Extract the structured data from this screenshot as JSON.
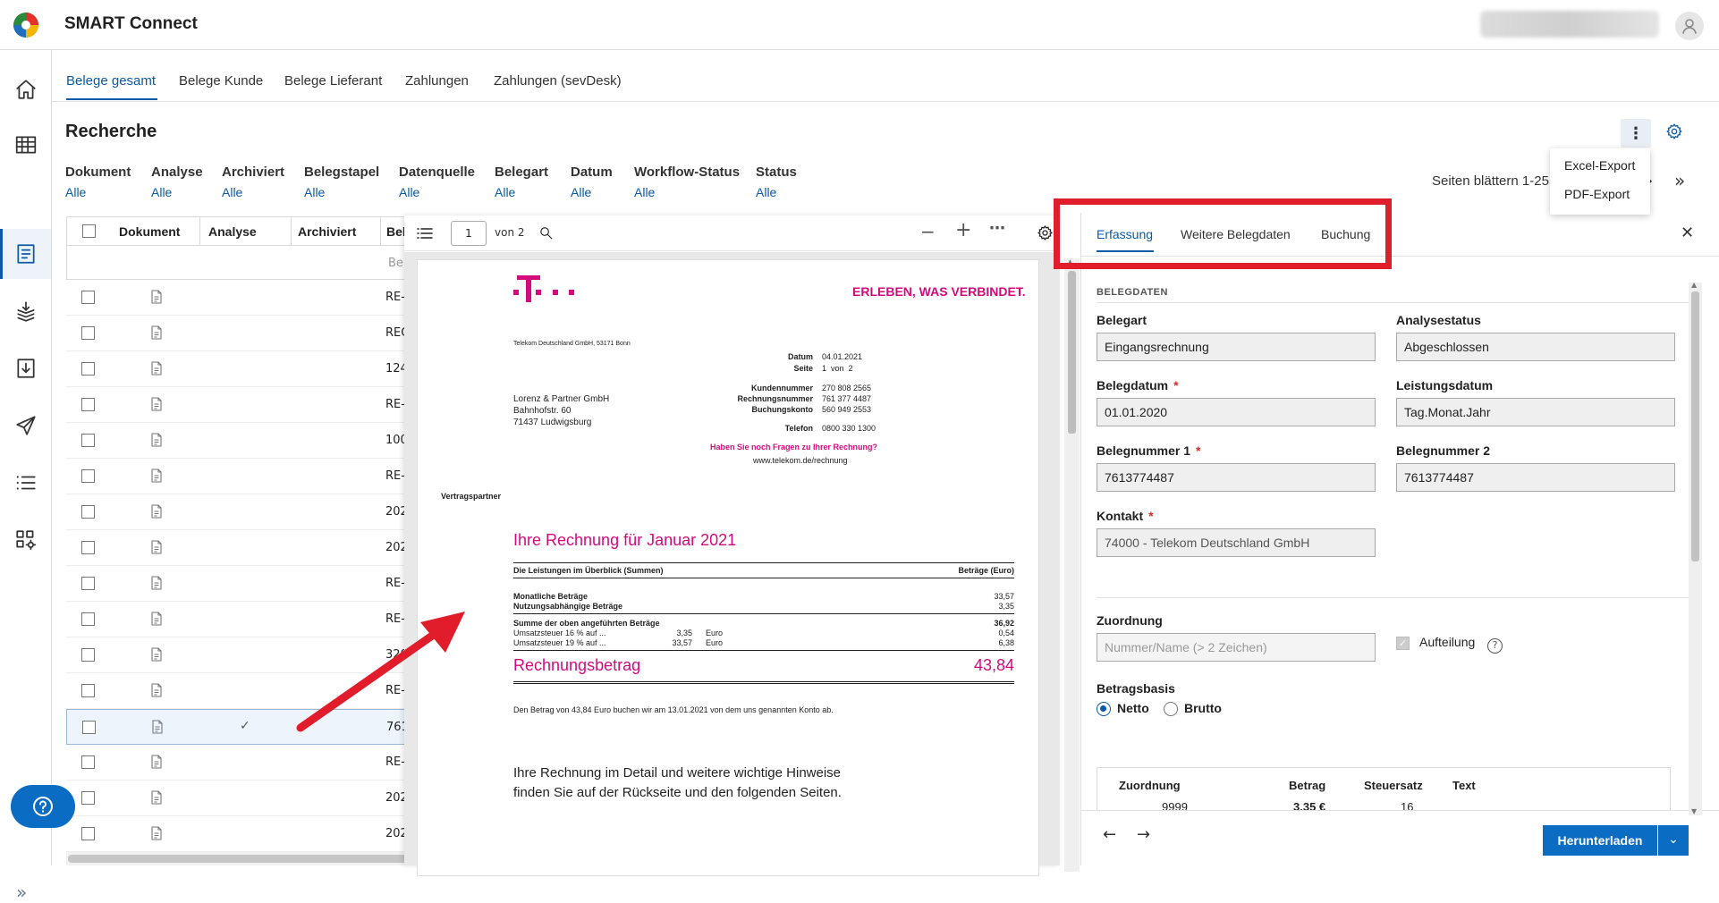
{
  "header": {
    "app_title": "SMART Connect"
  },
  "rail": {
    "items": [
      "home-icon",
      "table-icon",
      "document-icon",
      "stack-icon",
      "download-icon",
      "send-icon",
      "list-icon",
      "settings-grid-icon"
    ],
    "help": "?",
    "expand": "»"
  },
  "tabs": [
    "Belege gesamt",
    "Belege Kunde",
    "Belege Lieferant",
    "Zahlungen",
    "Zahlungen (sevDesk)"
  ],
  "page_title": "Recherche",
  "filters": [
    {
      "label": "Dokument",
      "value": "Alle"
    },
    {
      "label": "Analyse",
      "value": "Alle"
    },
    {
      "label": "Archiviert",
      "value": "Alle"
    },
    {
      "label": "Belegstapel",
      "value": "Alle"
    },
    {
      "label": "Datenquelle",
      "value": "Alle"
    },
    {
      "label": "Belegart",
      "value": "Alle"
    },
    {
      "label": "Datum",
      "value": "Alle"
    },
    {
      "label": "Workflow-Status",
      "value": "Alle"
    },
    {
      "label": "Status",
      "value": "Alle"
    }
  ],
  "pagination": {
    "text": "Seiten blättern 1-25",
    "next": "›",
    "last": "»"
  },
  "menu": {
    "excel": "Excel-Export",
    "pdf": "PDF-Export"
  },
  "table": {
    "headers": [
      "Dokument",
      "Analyse",
      "Archiviert",
      "Bel"
    ],
    "filter_placeholder": "Be",
    "rows": [
      {
        "beleg": "RE-",
        "analysed": false,
        "selected": false
      },
      {
        "beleg": "REC",
        "analysed": false,
        "selected": false
      },
      {
        "beleg": "124",
        "analysed": false,
        "selected": false
      },
      {
        "beleg": "RE-",
        "analysed": false,
        "selected": false
      },
      {
        "beleg": "100",
        "analysed": false,
        "selected": false
      },
      {
        "beleg": "RE-",
        "analysed": false,
        "selected": false
      },
      {
        "beleg": "202",
        "analysed": false,
        "selected": false
      },
      {
        "beleg": "202",
        "analysed": false,
        "selected": false
      },
      {
        "beleg": "RE-",
        "analysed": false,
        "selected": false
      },
      {
        "beleg": "RE-",
        "analysed": false,
        "selected": false
      },
      {
        "beleg": "320",
        "analysed": false,
        "selected": false
      },
      {
        "beleg": "RE-",
        "analysed": false,
        "selected": false
      },
      {
        "beleg": "761",
        "analysed": true,
        "selected": true
      },
      {
        "beleg": "RE-",
        "analysed": false,
        "selected": false
      },
      {
        "beleg": "202",
        "analysed": false,
        "selected": false
      },
      {
        "beleg": "202",
        "analysed": false,
        "selected": false
      }
    ]
  },
  "viewer": {
    "page": "1",
    "of": "von 2",
    "invoice": {
      "slogan": "ERLEBEN, WAS VERBINDET.",
      "sender": "Telekom Deutschland GmbH, 53171 Bonn",
      "datum_label": "Datum",
      "datum": "04.01.2021",
      "seite_label": "Seite",
      "seite": "1  von  2",
      "kunde_label": "Kundennummer",
      "kunde": "270 808 2565",
      "rech_label": "Rechnungsnummer",
      "rech": "761 377 4487",
      "konto_label": "Buchungskonto",
      "konto": "560 949 2553",
      "tel_label": "Telefon",
      "tel": "0800 330 1300",
      "question": "Haben Sie noch Fragen zu Ihrer Rechnung?",
      "url": "www.telekom.de/rechnung",
      "addr1": "Lorenz & Partner GmbH",
      "addr2": "Bahnhofstr. 60",
      "addr3": "71437 Ludwigsburg",
      "vertrag": "Vertragspartner",
      "heading": "Ihre Rechnung für Januar 2021",
      "sum_label": "Die Leistungen im Überblick (Summen)",
      "sum_currency": "Beträge (Euro)",
      "m1": "Monatliche Beträge",
      "m1v": "33,57",
      "m2": "Nutzungsabhängige Beträge",
      "m2v": "3,35",
      "total_label": "Summe der oben angeführten Beträge",
      "total": "36,92",
      "vat1": "Umsatzsteuer 16 % auf ...",
      "vat1b": "3,35",
      "vat1c": "Euro",
      "vat1v": "0,54",
      "vat2": "Umsatzsteuer 19 % auf ...",
      "vat2b": "33,57",
      "vat2c": "Euro",
      "vat2v": "6,38",
      "betrag_label": "Rechnungsbetrag",
      "betrag": "43,84",
      "note": "Den Betrag von 43,84 Euro buchen wir am 13.01.2021 von dem uns genannten Konto ab.",
      "detail1": "Ihre Rechnung im Detail und weitere wichtige Hinweise",
      "detail2": "finden Sie auf der Rückseite und den folgenden Seiten."
    }
  },
  "panel": {
    "tabs": [
      "Erfassung",
      "Weitere Belegdaten",
      "Buchung"
    ],
    "section": "BELEGDATEN",
    "belegart": {
      "label": "Belegart",
      "value": "Eingangsrechnung"
    },
    "analysestatus": {
      "label": "Analysestatus",
      "value": "Abgeschlossen"
    },
    "belegdatum": {
      "label": "Belegdatum",
      "value": "01.01.2020"
    },
    "leistungsdatum": {
      "label": "Leistungsdatum",
      "value": "Tag.Monat.Jahr"
    },
    "belegnummer1": {
      "label": "Belegnummer 1",
      "value": "7613774487"
    },
    "belegnummer2": {
      "label": "Belegnummer 2",
      "value": "7613774487"
    },
    "kontakt": {
      "label": "Kontakt",
      "value": "74000 - Telekom Deutschland GmbH"
    },
    "zuordnung": {
      "label": "Zuordnung",
      "placeholder": "Nummer/Name (> 2 Zeichen)"
    },
    "aufteilung": "Aufteilung",
    "betragsbasis": {
      "label": "Betragsbasis",
      "netto": "Netto",
      "brutto": "Brutto"
    },
    "subtable": {
      "headers": [
        "Zuordnung",
        "Betrag",
        "Steuersatz",
        "Text"
      ],
      "row": {
        "zuordnung": "9999",
        "betrag": "3,35 €",
        "steuersatz": "16"
      }
    },
    "download": "Herunterladen"
  }
}
